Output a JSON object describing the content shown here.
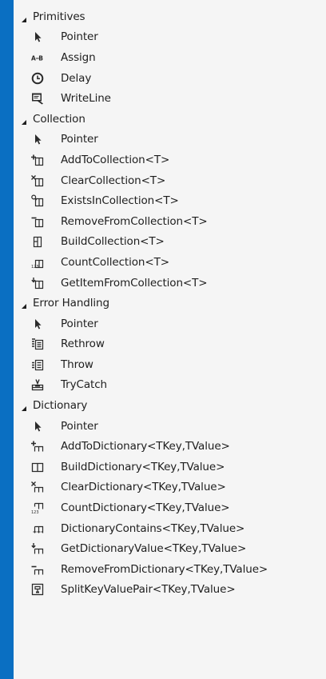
{
  "toolbox": {
    "categories": [
      {
        "label": "Primitives",
        "items": [
          {
            "label": "Pointer",
            "icon": "pointer-icon"
          },
          {
            "label": "Assign",
            "icon": "assign-icon"
          },
          {
            "label": "Delay",
            "icon": "clock-icon"
          },
          {
            "label": "WriteLine",
            "icon": "writeline-icon"
          }
        ]
      },
      {
        "label": "Collection",
        "items": [
          {
            "label": "Pointer",
            "icon": "pointer-icon"
          },
          {
            "label": "AddToCollection<T>",
            "icon": "add-to-collection-icon"
          },
          {
            "label": "ClearCollection<T>",
            "icon": "clear-collection-icon"
          },
          {
            "label": "ExistsInCollection<T>",
            "icon": "exists-in-collection-icon"
          },
          {
            "label": "RemoveFromCollection<T>",
            "icon": "remove-from-collection-icon"
          },
          {
            "label": "BuildCollection<T>",
            "icon": "build-collection-icon"
          },
          {
            "label": "CountCollection<T>",
            "icon": "count-collection-icon"
          },
          {
            "label": "GetItemFromCollection<T>",
            "icon": "get-item-from-collection-icon"
          }
        ]
      },
      {
        "label": "Error Handling",
        "items": [
          {
            "label": "Pointer",
            "icon": "pointer-icon"
          },
          {
            "label": "Rethrow",
            "icon": "rethrow-icon"
          },
          {
            "label": "Throw",
            "icon": "throw-icon"
          },
          {
            "label": "TryCatch",
            "icon": "trycatch-icon"
          }
        ]
      },
      {
        "label": "Dictionary",
        "items": [
          {
            "label": "Pointer",
            "icon": "pointer-icon"
          },
          {
            "label": "AddToDictionary<TKey,TValue>",
            "icon": "add-to-dictionary-icon"
          },
          {
            "label": "BuildDictionary<TKey,TValue>",
            "icon": "build-dictionary-icon"
          },
          {
            "label": "ClearDictionary<TKey,TValue>",
            "icon": "clear-dictionary-icon"
          },
          {
            "label": "CountDictionary<TKey,TValue>",
            "icon": "count-dictionary-icon"
          },
          {
            "label": "DictionaryContains<TKey,TValue>",
            "icon": "dictionary-contains-icon"
          },
          {
            "label": "GetDictionaryValue<TKey,TValue>",
            "icon": "get-dictionary-value-icon"
          },
          {
            "label": "RemoveFromDictionary<TKey,TValue>",
            "icon": "remove-from-dictionary-icon"
          },
          {
            "label": "SplitKeyValuePair<TKey,TValue>",
            "icon": "split-key-value-pair-icon"
          }
        ]
      }
    ]
  },
  "colors": {
    "frame": "#0a6fc2",
    "panel": "#f5f5f5",
    "text": "#1e1e1e",
    "icon": "#2b2b2b"
  }
}
